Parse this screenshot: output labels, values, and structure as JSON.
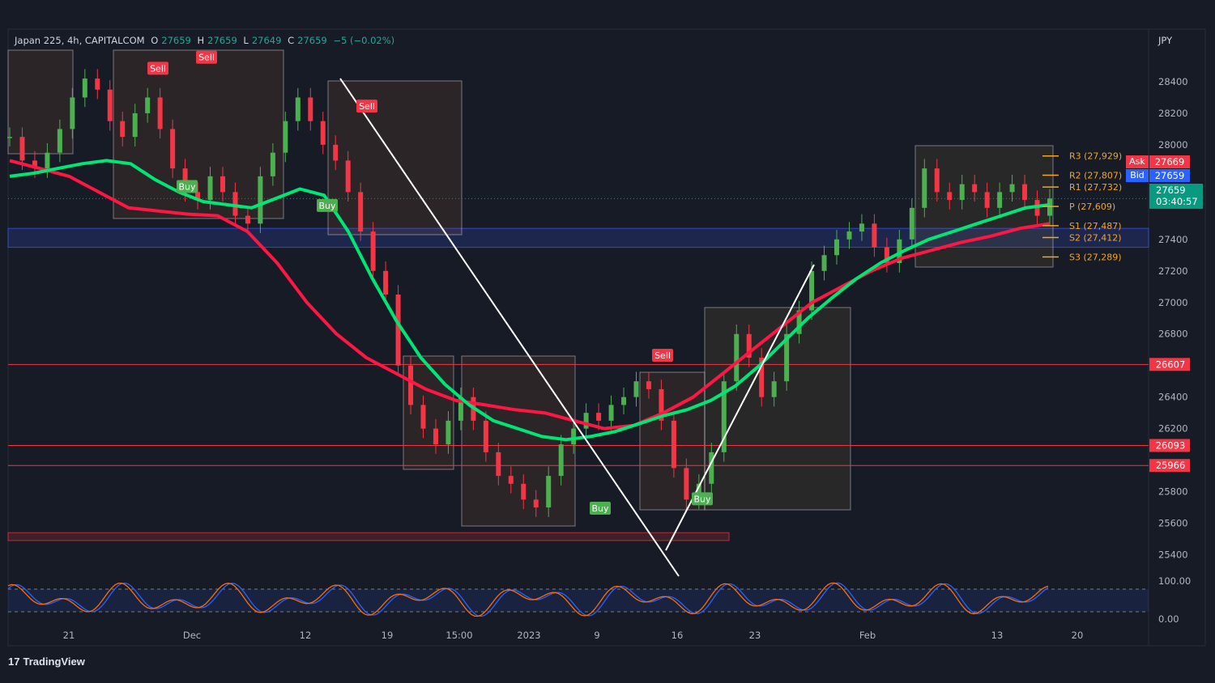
{
  "header": {
    "symbol": "Japan 225, 4h, CAPITALCOM",
    "o_label": "O",
    "o_value": "27659",
    "h_label": "H",
    "h_value": "27659",
    "l_label": "L",
    "l_value": "27649",
    "c_label": "C",
    "c_value": "27659",
    "change": "−5 (−0.02%)"
  },
  "currency": "JPY",
  "brand": "TradingView",
  "quote_tags": {
    "ask_label": "Ask",
    "ask_value": "27669",
    "bid_label": "Bid",
    "bid_value": "27659",
    "last_value": "27659",
    "countdown": "03:40:57"
  },
  "colors": {
    "background": "#171b26",
    "bull": "#4caf50",
    "bear": "#f23645",
    "ema_fast": "#00e676",
    "ema_slow": "#ff1744",
    "pivot": "#f5a623",
    "level_line": "#f23645",
    "zone": "#3d5afe",
    "oscillator_a": "#2962ff",
    "oscillator_b": "#ff6d00"
  },
  "chart_data": {
    "type": "line",
    "title": "",
    "xlabel": "",
    "ylabel": "",
    "x_ticks": [
      "21",
      "Dec",
      "12",
      "19",
      "15:00",
      "2023",
      "9",
      "16",
      "23",
      "Feb",
      "13",
      "20"
    ],
    "y_ticks": [
      28400,
      28200,
      28000,
      27400,
      27200,
      27000,
      26800,
      26400,
      26200,
      25800,
      25600,
      25400
    ],
    "ylim": [
      25300,
      28600
    ],
    "series": [
      {
        "values": [
          28050,
          27900,
          27850,
          27950,
          28100,
          28300,
          28420,
          28350,
          28150,
          28050,
          28200,
          28300,
          28100,
          27850,
          27700,
          27650,
          27800,
          27700,
          27550,
          27500,
          27800,
          27950,
          28150,
          28300,
          28150,
          28000,
          27900,
          27700,
          27450,
          27200,
          27050,
          26600,
          26350,
          26200,
          26100,
          26250,
          26400,
          26250,
          26050,
          25900,
          25850,
          25750,
          25700,
          25900,
          26100,
          26200,
          26300,
          26250,
          26350,
          26400,
          26500,
          26450,
          26250,
          25950,
          25750,
          25850,
          26050,
          26500,
          26800,
          26650,
          26400,
          26500,
          26800,
          26950,
          27200,
          27300,
          27400,
          27450,
          27500,
          27350,
          27250,
          27400,
          27600,
          27850,
          27700,
          27650,
          27750,
          27700,
          27600,
          27700,
          27750,
          27650,
          27550,
          27659
        ]
      }
    ],
    "ema_fast": [
      27800,
      27820,
      27850,
      27880,
      27900,
      27880,
      27780,
      27700,
      27640,
      27620,
      27600,
      27660,
      27720,
      27680,
      27450,
      27150,
      26880,
      26650,
      26480,
      26350,
      26250,
      26200,
      26150,
      26130,
      26150,
      26180,
      26230,
      26280,
      26320,
      26380,
      26470,
      26600,
      26750,
      26900,
      27030,
      27150,
      27250,
      27330,
      27400,
      27450,
      27500,
      27550,
      27600,
      27620
    ],
    "ema_slow": [
      27900,
      27850,
      27800,
      27700,
      27600,
      27580,
      27560,
      27550,
      27450,
      27250,
      27000,
      26800,
      26650,
      26550,
      26450,
      26380,
      26350,
      26320,
      26300,
      26250,
      26200,
      26220,
      26300,
      26400,
      26550,
      26700,
      26850,
      27000,
      27100,
      27200,
      27280,
      27330,
      27380,
      27420,
      27470,
      27500
    ],
    "sr_levels": [
      {
        "label": "26607",
        "value": 26607
      },
      {
        "label": "26093",
        "value": 26093
      },
      {
        "label": "25966",
        "value": 25966
      }
    ],
    "pivots": [
      {
        "label": "R3 (27,929)",
        "value": 27929
      },
      {
        "label": "R2 (27,807)",
        "value": 27807
      },
      {
        "label": "R1 (27,732)",
        "value": 27732
      },
      {
        "label": "P (27,609)",
        "value": 27609
      },
      {
        "label": "S1 (27,487)",
        "value": 27487
      },
      {
        "label": "S2 (27,412)",
        "value": 27412
      },
      {
        "label": "S3 (27,289)",
        "value": 27289
      }
    ],
    "signals": [
      {
        "label": "Sell",
        "date": "Nov 25",
        "price": 28480
      },
      {
        "label": "Sell",
        "date": "Nov 30",
        "price": 28550
      },
      {
        "label": "Buy",
        "date": "Nov 29",
        "price": 27730
      },
      {
        "label": "Buy",
        "date": "Dec 14",
        "price": 27610
      },
      {
        "label": "Sell",
        "date": "Dec 17",
        "price": 28240
      },
      {
        "label": "Buy",
        "date": "Jan 6",
        "price": 25690
      },
      {
        "label": "Sell",
        "date": "Jan 14",
        "price": 26660
      },
      {
        "label": "Buy",
        "date": "Jan 17",
        "price": 25750
      }
    ],
    "oscillator": {
      "ticks": [
        "100.00",
        "0.00"
      ]
    }
  }
}
